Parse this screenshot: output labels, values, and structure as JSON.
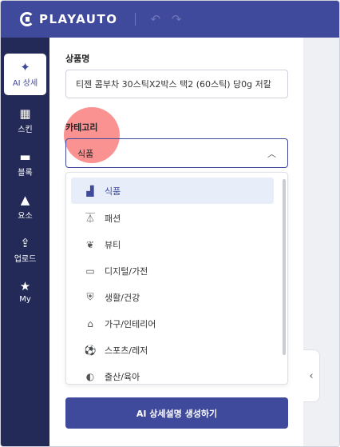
{
  "header": {
    "logo_text": "PLAYAUTO",
    "undo_icon": "undo-icon",
    "redo_icon": "redo-icon"
  },
  "sidebar": {
    "items": [
      {
        "label": "AI 상세",
        "icon": "sparkle-icon",
        "glyph": "✦",
        "active": true
      },
      {
        "label": "스킨",
        "icon": "grid-plus-icon",
        "glyph": "▦",
        "active": false
      },
      {
        "label": "블록",
        "icon": "block-icon",
        "glyph": "▬",
        "active": false
      },
      {
        "label": "요소",
        "icon": "shapes-icon",
        "glyph": "▲",
        "active": false
      },
      {
        "label": "업로드",
        "icon": "upload-icon",
        "glyph": "⇪",
        "active": false
      },
      {
        "label": "My",
        "icon": "star-icon",
        "glyph": "★",
        "active": false
      }
    ]
  },
  "main": {
    "product_name_label": "상품명",
    "product_name_value": "티젠 콤부차 30스틱X2박스 택2 (60스틱) 당0g 저칼",
    "category_label": "카테고리",
    "category_selected": "식품",
    "category_options": [
      {
        "label": "식품",
        "icon": "food-icon",
        "glyph": "▟",
        "selected": true
      },
      {
        "label": "패션",
        "icon": "hanger-icon",
        "glyph": "⏄",
        "selected": false
      },
      {
        "label": "뷰티",
        "icon": "beauty-icon",
        "glyph": "❦",
        "selected": false
      },
      {
        "label": "디지털/가전",
        "icon": "laptop-icon",
        "glyph": "▭",
        "selected": false
      },
      {
        "label": "생활/건강",
        "icon": "shield-icon",
        "glyph": "⛨",
        "selected": false
      },
      {
        "label": "가구/인테리어",
        "icon": "home-icon",
        "glyph": "⌂",
        "selected": false
      },
      {
        "label": "스포츠/레저",
        "icon": "ball-icon",
        "glyph": "⚽",
        "selected": false
      },
      {
        "label": "출산/육아",
        "icon": "baby-icon",
        "glyph": "◐",
        "selected": false
      }
    ],
    "generate_button_label": "AI 상세설명 생성하기"
  },
  "colors": {
    "brand": "#3f4a9c",
    "sidebar_bg": "#232a57",
    "highlight": "#f86e6e"
  }
}
